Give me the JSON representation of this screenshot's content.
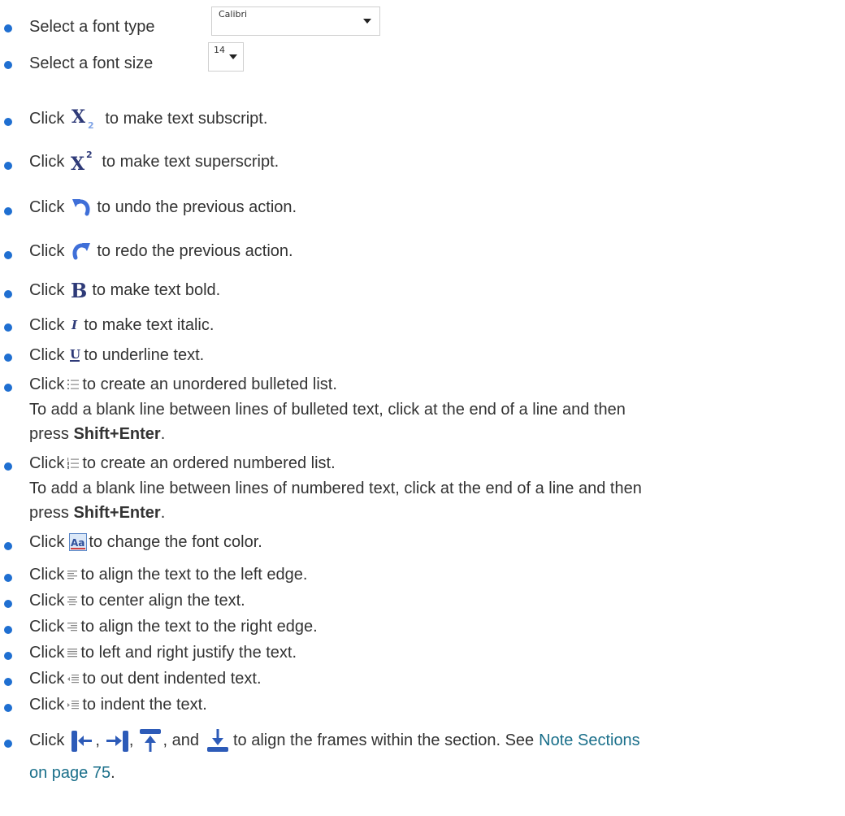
{
  "colors": {
    "bullet": "#1f6fd1",
    "link": "#1a6f8a",
    "text": "#333333"
  },
  "font_type": {
    "label": "Select a font type",
    "value": "Calibri"
  },
  "font_size": {
    "label": "Select a font size",
    "value": "14"
  },
  "items": {
    "subscript": {
      "click": "Click",
      "text": "to make text subscript.",
      "icon": "subscript-icon"
    },
    "superscript": {
      "click": "Click",
      "text": "to make text superscript.",
      "icon": "superscript-icon"
    },
    "undo": {
      "click": "Click",
      "text": "to undo the previous action.",
      "icon": "undo-icon"
    },
    "redo": {
      "click": "Click",
      "text": "to redo the previous action.",
      "icon": "redo-icon"
    },
    "bold": {
      "click": "Click",
      "text": "to make text bold.",
      "icon": "bold-icon"
    },
    "italic": {
      "click": "Click",
      "text": "to make text italic.",
      "icon": "italic-icon"
    },
    "underline": {
      "click": "Click",
      "text": "to underline text.",
      "icon": "underline-icon"
    },
    "unordered": {
      "click": "Click",
      "text": "to create an unordered bulleted list.",
      "icon": "unordered-list-icon",
      "note1": "To add a blank line between lines of bulleted text, click at the end of a line and then",
      "note2_pre": "press ",
      "note2_bold": "Shift+Enter",
      "note2_post": "."
    },
    "ordered": {
      "click": "Click",
      "text": "to create an ordered numbered list.",
      "icon": "ordered-list-icon",
      "note1": "To add a blank line between lines of numbered text, click at the end of a line and then",
      "note2_pre": "press ",
      "note2_bold": "Shift+Enter",
      "note2_post": "."
    },
    "font_color": {
      "click": "Click",
      "text": "to change the font color.",
      "icon": "font-color-icon"
    },
    "align_left": {
      "click": "Click",
      "text": "to align the text to the left edge.",
      "icon": "align-left-icon"
    },
    "align_center": {
      "click": "Click",
      "text": "to center align the text.",
      "icon": "align-center-icon"
    },
    "align_right": {
      "click": "Click",
      "text": "to align the text to the right edge.",
      "icon": "align-right-icon"
    },
    "justify": {
      "click": "Click",
      "text": "to left and right justify the text.",
      "icon": "justify-icon"
    },
    "outdent": {
      "click": "Click",
      "text": "to out dent indented text.",
      "icon": "outdent-icon"
    },
    "indent": {
      "click": "Click",
      "text": "to indent the text.",
      "icon": "indent-icon"
    },
    "frames": {
      "click": "Click",
      "comma1": ",",
      "comma2": ",",
      "and": ", and",
      "text": "to align the frames within the section. See",
      "link1": "Note Sections",
      "link2": "on page 75",
      "end": "."
    }
  }
}
